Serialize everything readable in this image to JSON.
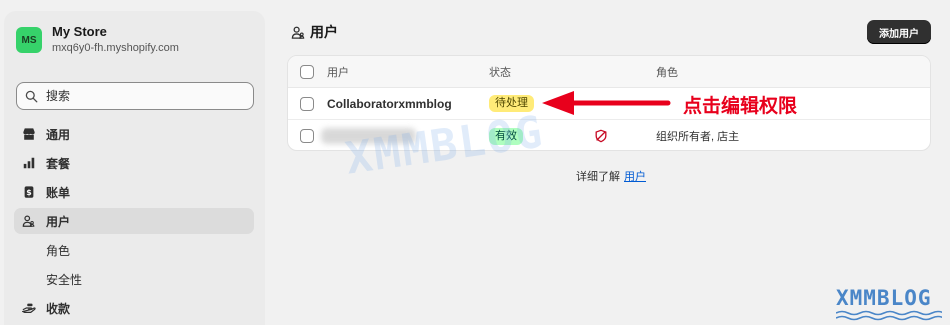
{
  "store": {
    "initials": "MS",
    "name": "My Store",
    "domain": "mxq6y0-fh.myshopify.com"
  },
  "search": {
    "placeholder": "搜索"
  },
  "nav": {
    "items": [
      {
        "label": "通用",
        "icon": "store-icon"
      },
      {
        "label": "套餐",
        "icon": "chart-bars-icon"
      },
      {
        "label": "账单",
        "icon": "dollar-receipt-icon"
      },
      {
        "label": "用户",
        "icon": "users-icon",
        "active": true
      },
      {
        "label": "角色",
        "sub": true
      },
      {
        "label": "安全性",
        "sub": true
      },
      {
        "label": "收款",
        "icon": "hand-payment-icon"
      }
    ]
  },
  "main": {
    "title": "用户",
    "add_button": "添加用户",
    "table": {
      "headers": [
        "用户",
        "状态",
        "角色"
      ],
      "rows": [
        {
          "user": "Collaboratorxmmblog",
          "status": "待处理",
          "role": ""
        },
        {
          "user": "",
          "status": "有效",
          "role": "组织所有者, 店主"
        }
      ]
    },
    "learn_more_prefix": "详细了解",
    "learn_more_link": "用户"
  },
  "annotation": {
    "text": "点击编辑权限",
    "color": "#e8001c"
  },
  "watermark": {
    "text": "XMMBLOG"
  },
  "colors": {
    "avatar": "#36d26a",
    "pending_badge": "#ffeb78",
    "active_badge": "#affebf",
    "primary_button": "#303030",
    "link": "#005bd3"
  }
}
